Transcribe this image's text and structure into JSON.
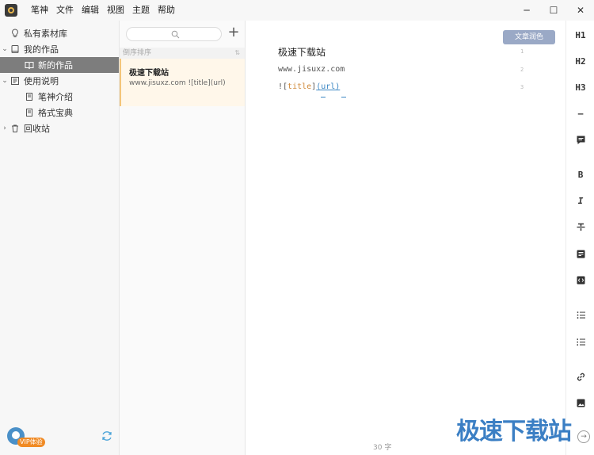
{
  "menu": [
    "笔神",
    "文件",
    "编辑",
    "视图",
    "主题",
    "帮助"
  ],
  "window_controls": {
    "minimize": "─",
    "maximize": "☐",
    "close": "✕"
  },
  "sidebar": {
    "items": [
      {
        "label": "私有素材库",
        "icon": "lightbulb-icon"
      },
      {
        "label": "我的作品",
        "icon": "book-icon",
        "expanded": true
      },
      {
        "label": "新的作品",
        "icon": "open-book-icon",
        "selected": true
      },
      {
        "label": "使用说明",
        "icon": "manual-icon",
        "expanded": true
      },
      {
        "label": "笔神介绍",
        "icon": "doc-icon"
      },
      {
        "label": "格式宝典",
        "icon": "doc-icon"
      },
      {
        "label": "回收站",
        "icon": "trash-icon",
        "expanded": false
      }
    ],
    "vip_badge": "VIP体验"
  },
  "doclist": {
    "sort_label": "倒序排序",
    "add": "+",
    "docs": [
      {
        "title": "极速下载站",
        "snippet": "www.jisuxz.com ![title](url)"
      }
    ]
  },
  "editor": {
    "polish_button": "文章润色",
    "heading": "极速下载站",
    "url_line": "www.jisuxz.com",
    "image_syntax": {
      "bang": "![",
      "title": "title",
      "mid": "]",
      "url": "(url)"
    },
    "line_numbers": [
      "1",
      "2",
      "3"
    ],
    "word_count": "30 字"
  },
  "toolbar": {
    "h1": "H1",
    "h2": "H2",
    "h3": "H3",
    "hr": "—",
    "bold": "B",
    "italic": "I"
  },
  "watermark": "极速下载站",
  "colors": {
    "accent": "#3b7fc4",
    "selected_row": "#7d7d7d",
    "polish_button": "#9aa9c6",
    "card_bg": "#fff7ea"
  }
}
